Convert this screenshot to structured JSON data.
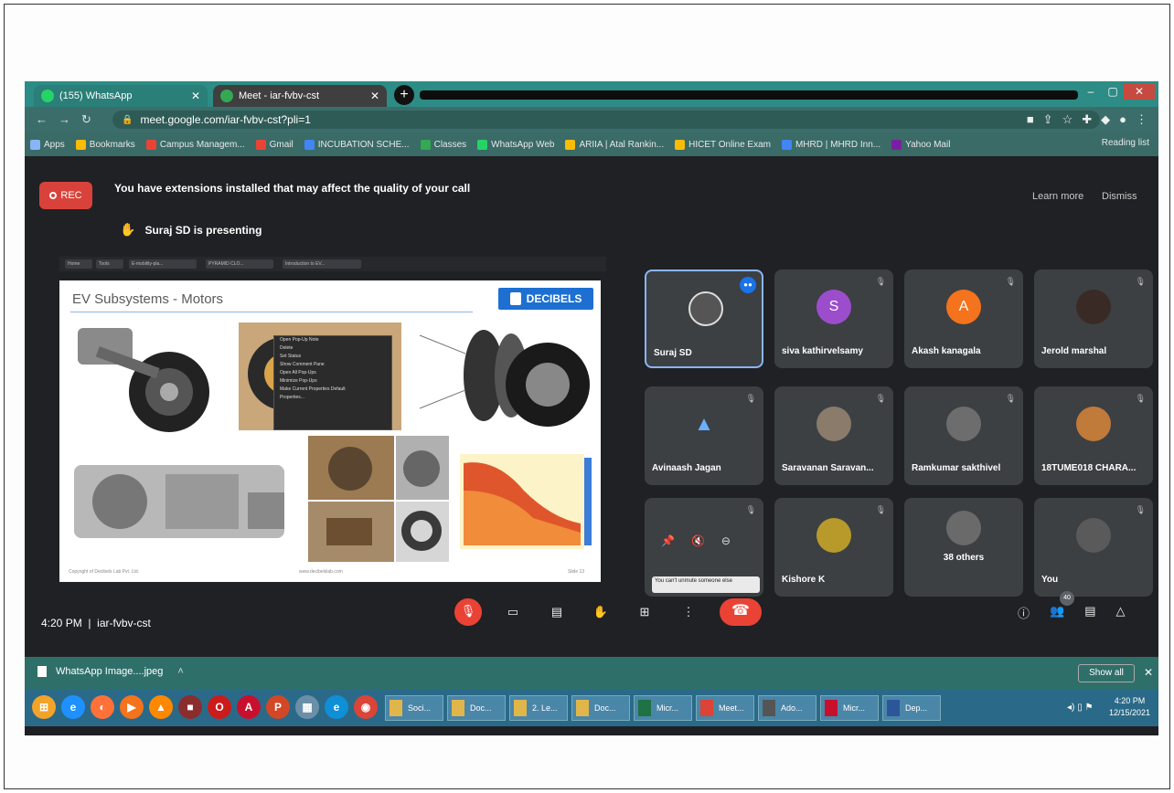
{
  "browser": {
    "tabs": [
      {
        "label": "(155) WhatsApp",
        "favicon_color": "#25d366"
      },
      {
        "label": "Meet - iar-fvbv-cst",
        "favicon_color": "#34a853"
      }
    ],
    "new_tab_label": "+",
    "url": "meet.google.com/iar-fvbv-cst?pli=1",
    "bookmarks": [
      {
        "label": "Apps",
        "color": "#8ab4f8"
      },
      {
        "label": "Bookmarks",
        "color": "#fbbc04"
      },
      {
        "label": "Campus Managem...",
        "color": "#ea4335"
      },
      {
        "label": "Gmail",
        "color": "#ea4335"
      },
      {
        "label": "INCUBATION SCHE...",
        "color": "#4285f4"
      },
      {
        "label": "Classes",
        "color": "#34a853"
      },
      {
        "label": "WhatsApp Web",
        "color": "#25d366"
      },
      {
        "label": "ARIIA | Atal Rankin...",
        "color": "#fbbc04"
      },
      {
        "label": "HICET Online Exam",
        "color": "#fbbc04"
      },
      {
        "label": "MHRD | MHRD Inn...",
        "color": "#4285f4"
      },
      {
        "label": "Yahoo Mail",
        "color": "#7b1fa2"
      }
    ],
    "reading_list": "Reading list"
  },
  "meet": {
    "rec_label": "REC",
    "extension_message": "You have extensions installed that may affect the quality of your call",
    "learn_more": "Learn more",
    "dismiss": "Dismiss",
    "presenting": "Suraj SD is presenting",
    "slide": {
      "title": "EV Subsystems - Motors",
      "brand": "DECIBELS",
      "context_menu": [
        "Open Pop-Up Note",
        "Delete",
        "Set Status",
        "Show Comment Pane",
        "Open All Pop-Ups",
        "Minimize Pop-Ups",
        "Make Current Properties Default",
        "Properties..."
      ],
      "footer_left": "Copyright of Decibels Lab Pvt. Ltd.",
      "footer_mid": "www.decibelslab.com",
      "footer_right": "Slide 13",
      "mini_tabs": [
        "Home",
        "Tools",
        "E-mobility-pla...",
        "PYRAMID CLO...",
        "Introduction to EV..."
      ]
    },
    "participants": [
      {
        "name": "Suraj SD",
        "initial": "",
        "color": "#555555",
        "active": true
      },
      {
        "name": "siva kathirvelsamy",
        "initial": "S",
        "color": "#9c4dcc"
      },
      {
        "name": "Akash kanagala",
        "initial": "A",
        "color": "#f4731c"
      },
      {
        "name": "Jerold marshal",
        "initial": "",
        "color": "#3a2a26"
      },
      {
        "name": "Avinaash Jagan",
        "initial": "",
        "color": "#3c4043"
      },
      {
        "name": "Saravanan Saravan...",
        "initial": "",
        "color": "#8a7b6a"
      },
      {
        "name": "Ramkumar sakthivel",
        "initial": "",
        "color": "#6d6d6d"
      },
      {
        "name": "18TUME018 CHARA...",
        "initial": "",
        "color": "#c07a3a"
      },
      {
        "name": "",
        "initial": "",
        "color": "#3c4043"
      },
      {
        "name": "Kishore K",
        "initial": "",
        "color": "#b89a2a"
      },
      {
        "name": "38 others",
        "initial": "",
        "color": "#6a6a6a"
      },
      {
        "name": "You",
        "initial": "",
        "color": "#5a5a5a"
      }
    ],
    "caption": "You can't unmute someone else",
    "clock": "4:20 PM",
    "meeting_code": "iar-fvbv-cst",
    "people_count": "40"
  },
  "downloads": {
    "item": "WhatsApp Image....jpeg",
    "show_all": "Show all"
  },
  "taskbar": {
    "pinned": [
      {
        "icon": "chrome-icon",
        "color": "#db4437",
        "glyph": "◉"
      },
      {
        "icon": "ie-icon",
        "color": "#1e90ff",
        "glyph": "e"
      },
      {
        "icon": "firefox-icon",
        "color": "#ff7139",
        "glyph": "◐"
      },
      {
        "icon": "media-icon",
        "color": "#f4731c",
        "glyph": "▶"
      },
      {
        "icon": "vlc-icon",
        "color": "#ff8800",
        "glyph": "▲"
      },
      {
        "icon": "winrar-icon",
        "color": "#8b2d2d",
        "glyph": "■"
      },
      {
        "icon": "opera-icon",
        "color": "#cc1b1b",
        "glyph": "O"
      },
      {
        "icon": "pdf-icon",
        "color": "#c8102e",
        "glyph": "A"
      },
      {
        "icon": "powerpoint-icon",
        "color": "#d24726",
        "glyph": "P"
      },
      {
        "icon": "calculator-icon",
        "color": "#6b8fa8",
        "glyph": "▦"
      },
      {
        "icon": "edge-icon",
        "color": "#0f8fd6",
        "glyph": "e"
      },
      {
        "icon": "chrome2-icon",
        "color": "#db4437",
        "glyph": "◉"
      }
    ],
    "tasks": [
      {
        "label": "Soci...",
        "color": "#e0b64a"
      },
      {
        "label": "Doc...",
        "color": "#e0b64a"
      },
      {
        "label": "2. Le...",
        "color": "#e0b64a"
      },
      {
        "label": "Doc...",
        "color": "#e0b64a"
      },
      {
        "label": "Micr...",
        "color": "#1f7244"
      },
      {
        "label": "Meet...",
        "color": "#db4437"
      },
      {
        "label": "Ado...",
        "color": "#555555"
      },
      {
        "label": "Micr...",
        "color": "#c8102e"
      },
      {
        "label": "Dep...",
        "color": "#2b579a"
      }
    ],
    "time": "4:20 PM",
    "date": "12/15/2021"
  }
}
